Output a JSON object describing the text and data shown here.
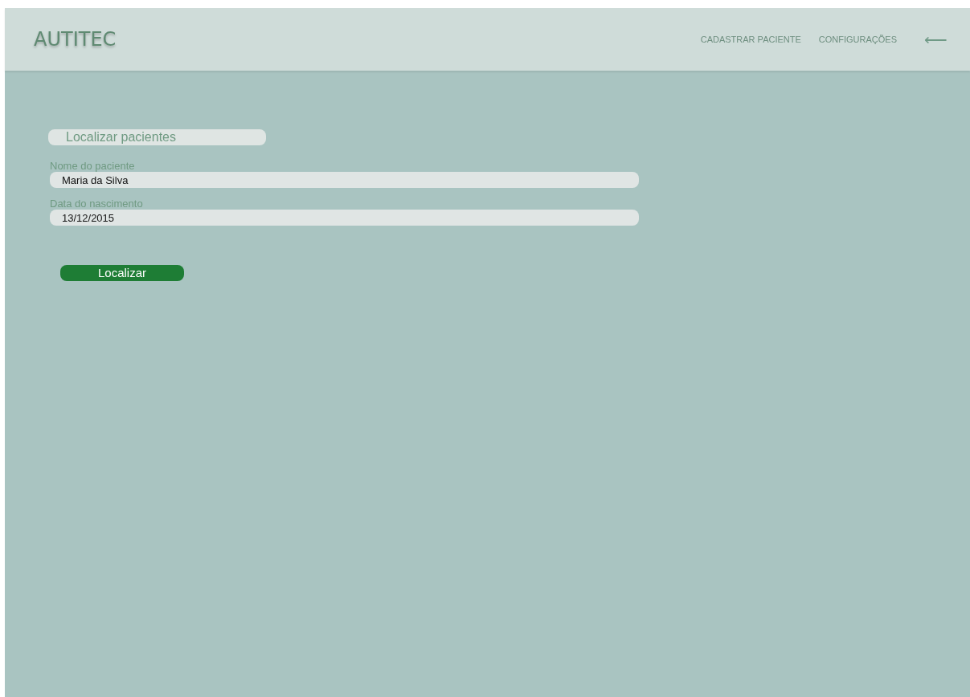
{
  "header": {
    "logo": "AUTITEC",
    "nav": [
      "CADASTRAR PACIENTE",
      "CONFIGURAÇÕES"
    ],
    "back_icon": "⟵"
  },
  "search": {
    "title": "Localizar pacientes",
    "fields": [
      {
        "label": "Nome do paciente",
        "value": "Maria da Silva"
      },
      {
        "label": "Data do nascimento",
        "value": "13/12/2015"
      }
    ],
    "button": "Localizar"
  }
}
